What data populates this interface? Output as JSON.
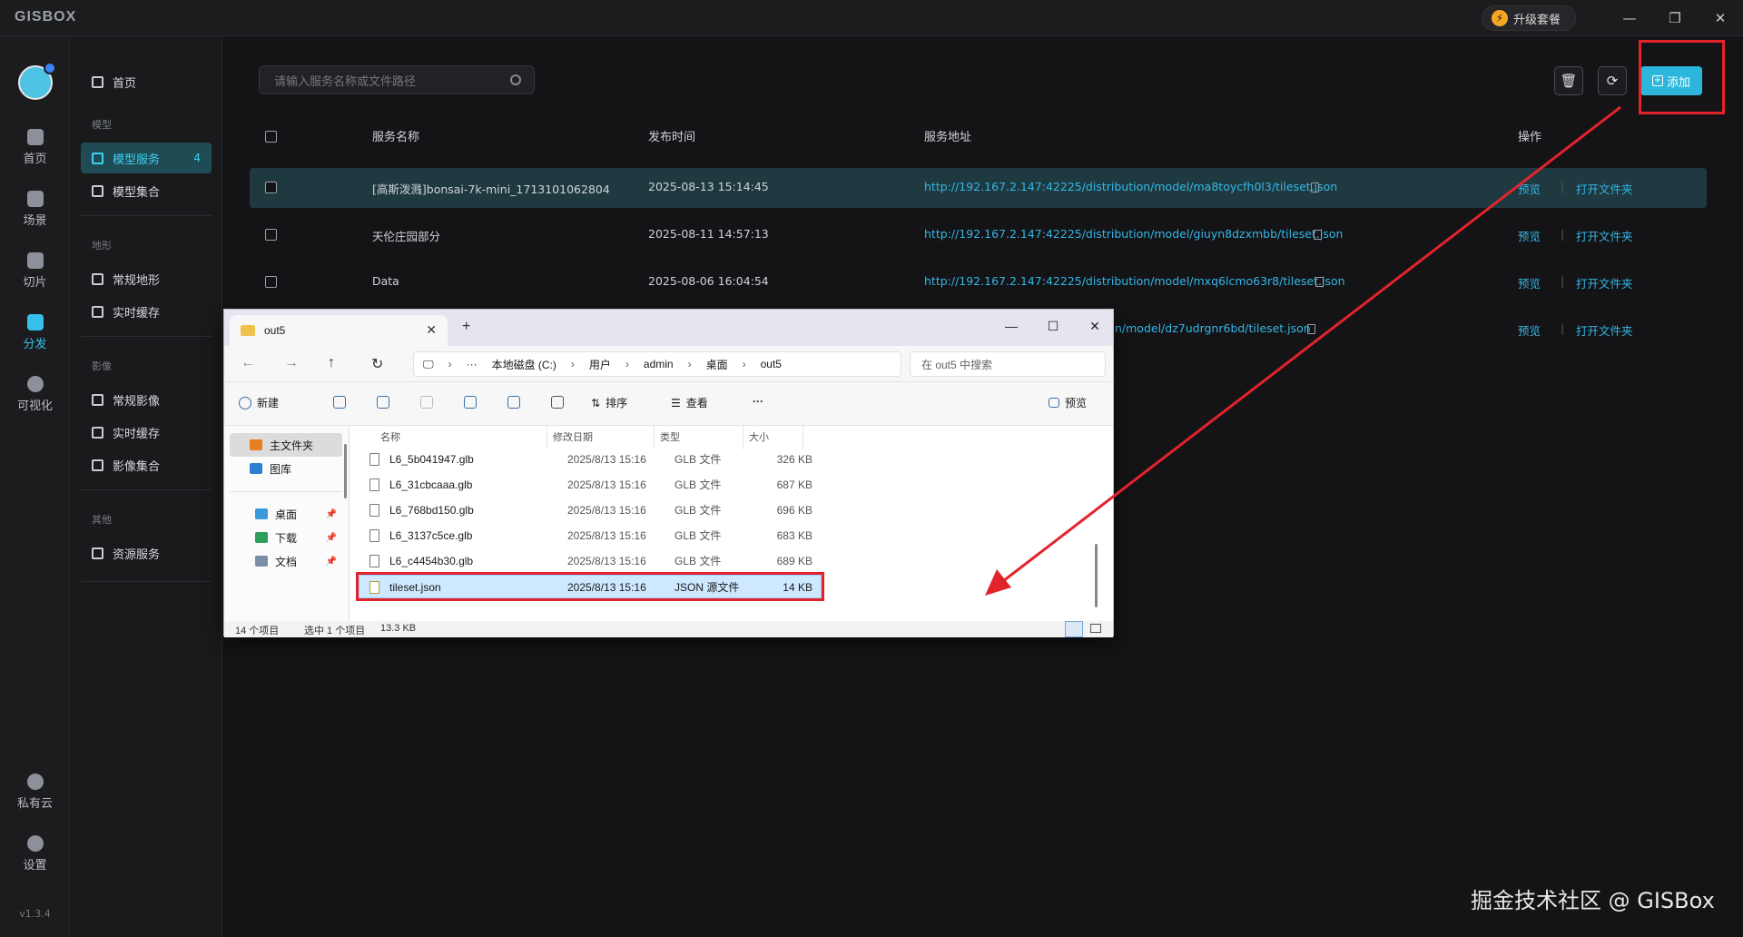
{
  "app": {
    "logo": "GISBOX",
    "upgrade": "升级套餐",
    "version": "v1.3.4"
  },
  "rail": [
    {
      "label": "首页"
    },
    {
      "label": "场景"
    },
    {
      "label": "切片"
    },
    {
      "label": "分发"
    },
    {
      "label": "可视化"
    },
    {
      "label": "私有云"
    },
    {
      "label": "设置"
    }
  ],
  "nav": {
    "home": "首页",
    "group_model": "模型",
    "model_service": "模型服务",
    "model_service_count": "4",
    "model_set": "模型集合",
    "group_terrain": "地形",
    "terrain_normal": "常规地形",
    "terrain_cache": "实时缓存",
    "group_image": "影像",
    "image_normal": "常规影像",
    "image_cache": "实时缓存",
    "image_set": "影像集合",
    "group_other": "其他",
    "resource_service": "资源服务"
  },
  "toolbar": {
    "search_placeholder": "请输入服务名称或文件路径",
    "add": "添加"
  },
  "table": {
    "headers": {
      "name": "服务名称",
      "time": "发布时间",
      "url": "服务地址",
      "ops": "操作"
    },
    "preview": "预览",
    "open_folder": "打开文件夹",
    "rows": [
      {
        "name": "[高斯泼溅]bonsai-7k-mini_1713101062804",
        "time": "2025-08-13 15:14:45",
        "url": "http://192.167.2.147:42225/distribution/model/ma8toycfh0l3/tileset.json"
      },
      {
        "name": "天伦庄园部分",
        "time": "2025-08-11 14:57:13",
        "url": "http://192.167.2.147:42225/distribution/model/giuyn8dzxmbb/tileset.json"
      },
      {
        "name": "Data",
        "time": "2025-08-06 16:04:54",
        "url": "http://192.167.2.147:42225/distribution/model/mxq6lcmo63r8/tileset.json"
      },
      {
        "name": "",
        "time": "",
        "url": "n/model/dz7udrgnr6bd/tileset.json"
      }
    ]
  },
  "explorer": {
    "tab_title": "out5",
    "breadcrumb": [
      "本地磁盘 (C:)",
      "用户",
      "admin",
      "桌面",
      "out5"
    ],
    "search_placeholder": "在 out5 中搜索",
    "cmd": {
      "new": "新建",
      "sort": "排序",
      "view": "查看",
      "more": "···",
      "preview": "预览"
    },
    "pane": {
      "home": "主文件夹",
      "gallery": "图库",
      "desktop": "桌面",
      "downloads": "下载",
      "documents": "文档"
    },
    "columns": {
      "name": "名称",
      "date": "修改日期",
      "type": "类型",
      "size": "大小"
    },
    "files": [
      {
        "name": "L6_5b041947.glb",
        "date": "2025/8/13 15:16",
        "type": "GLB 文件",
        "size": "326 KB"
      },
      {
        "name": "L6_31cbcaaa.glb",
        "date": "2025/8/13 15:16",
        "type": "GLB 文件",
        "size": "687 KB"
      },
      {
        "name": "L6_768bd150.glb",
        "date": "2025/8/13 15:16",
        "type": "GLB 文件",
        "size": "696 KB"
      },
      {
        "name": "L6_3137c5ce.glb",
        "date": "2025/8/13 15:16",
        "type": "GLB 文件",
        "size": "683 KB"
      },
      {
        "name": "L6_c4454b30.glb",
        "date": "2025/8/13 15:16",
        "type": "GLB 文件",
        "size": "689 KB"
      },
      {
        "name": "tileset.json",
        "date": "2025/8/13 15:16",
        "type": "JSON 源文件",
        "size": "14 KB"
      }
    ],
    "status": {
      "count": "14 个项目",
      "selected": "选中 1 个项目",
      "size": "13.3 KB"
    }
  },
  "watermark": "掘金技术社区 @ GISBox",
  "colors": {
    "accent": "#2cb6dc",
    "annotation": "#e3232b"
  }
}
